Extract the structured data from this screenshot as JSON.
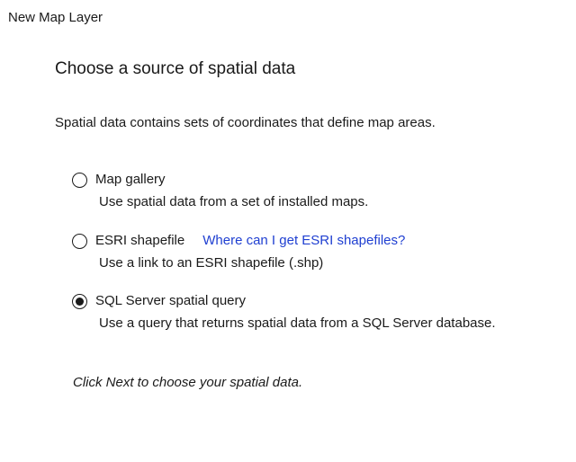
{
  "window": {
    "title": "New Map Layer"
  },
  "page": {
    "heading": "Choose a source of spatial data",
    "description": "Spatial data contains sets of coordinates that define map areas."
  },
  "options": [
    {
      "label": "Map gallery",
      "description": "Use spatial data from a set of installed maps.",
      "selected": false
    },
    {
      "label": "ESRI shapefile",
      "link": "Where can I get ESRI shapefiles?",
      "description": "Use a link to an ESRI shapefile (.shp)",
      "selected": false
    },
    {
      "label": "SQL Server spatial query",
      "description": "Use a query that returns spatial data from a SQL Server database.",
      "selected": true
    }
  ],
  "footer": {
    "hint": "Click Next to choose your spatial data."
  },
  "colors": {
    "link": "#1f3fd1",
    "text": "#1a1a1a",
    "background": "#ffffff"
  }
}
